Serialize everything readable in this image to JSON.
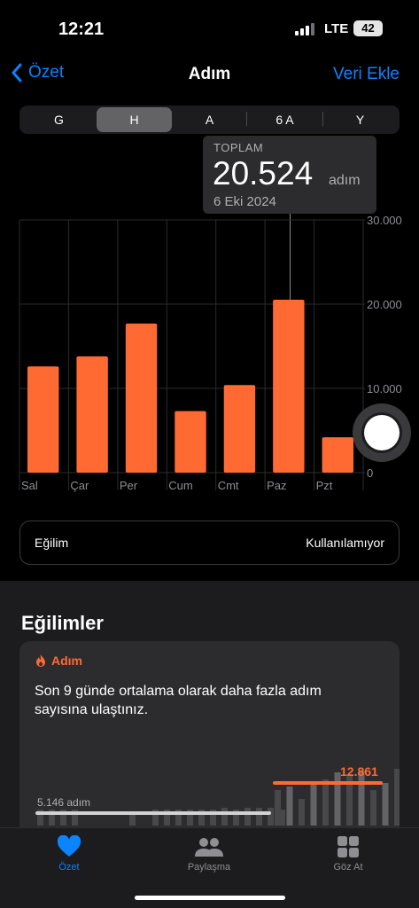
{
  "status_bar": {
    "time": "12:21",
    "network": "LTE",
    "battery": "42"
  },
  "nav": {
    "back_label": "Özet",
    "title": "Adım",
    "add_label": "Veri Ekle"
  },
  "segments": {
    "options": [
      "G",
      "H",
      "A",
      "6 A",
      "Y"
    ],
    "selected": "H"
  },
  "tooltip": {
    "label": "TOPLAM",
    "value": "20.524",
    "unit": "adım",
    "date": "6 Eki 2024"
  },
  "chart_data": {
    "type": "bar",
    "categories": [
      "Sal",
      "Çar",
      "Per",
      "Cum",
      "Cmt",
      "Paz",
      "Pzt"
    ],
    "values": [
      12600,
      13800,
      17700,
      7300,
      10400,
      20524,
      4200
    ],
    "ylim": [
      0,
      30000
    ],
    "yticks": [
      "30.000",
      "20.000",
      "10.000",
      "0"
    ],
    "ytick_values": [
      30000,
      20000,
      10000,
      0
    ],
    "highlighted": "Paz",
    "bar_color": "#ff6a33",
    "grid": true
  },
  "trend_row": {
    "label": "Eğilim",
    "value": "Kullanılamıyor"
  },
  "trends": {
    "title": "Eğilimler",
    "card": {
      "category": "Adım",
      "description": "Son 9 günde ortalama olarak daha fazla adım sayısına ulaştınız.",
      "old_avg_label": "5.146 adım",
      "new_avg_label": "12.861",
      "accent_color": "#ff6a33"
    }
  },
  "tabbar": {
    "tabs": [
      {
        "label": "Özet",
        "icon": "heart-icon",
        "active": true
      },
      {
        "label": "Paylaşma",
        "icon": "people-icon",
        "active": false
      },
      {
        "label": "Göz At",
        "icon": "grid-icon",
        "active": false
      }
    ]
  }
}
